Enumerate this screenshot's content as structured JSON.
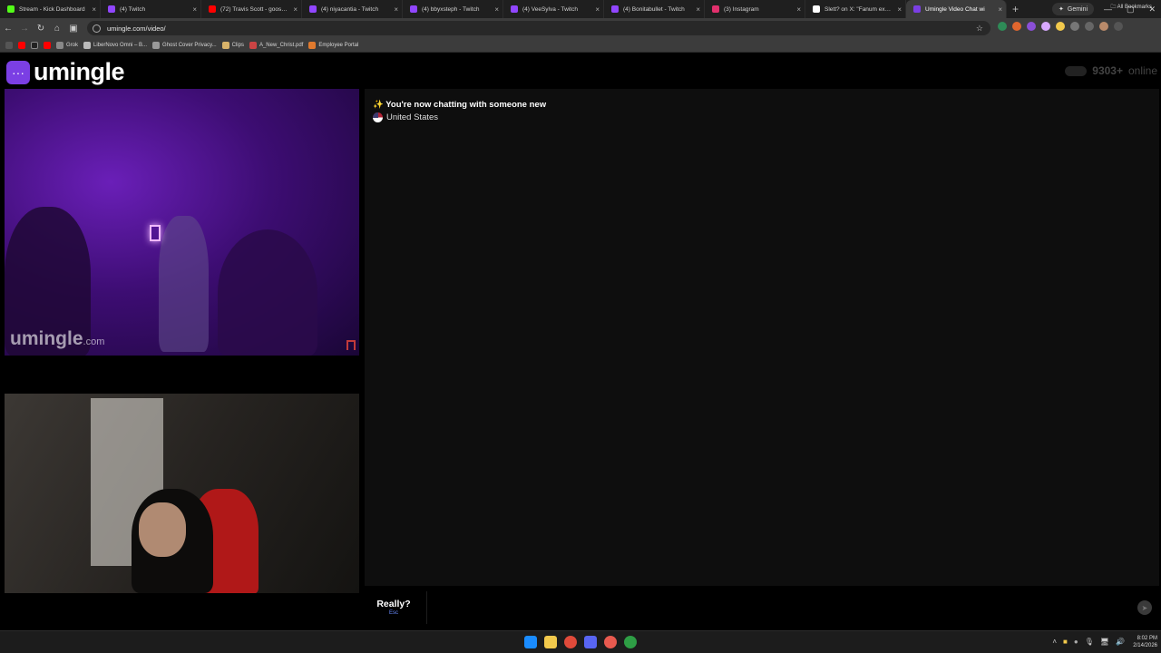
{
  "browser": {
    "tabs": [
      {
        "title": "Stream - Kick Dashboard",
        "color": "#53fc18"
      },
      {
        "title": "(4) Twitch",
        "color": "#9146ff"
      },
      {
        "title": "(72) Travis Scott - goosebum",
        "color": "#ff0000"
      },
      {
        "title": "(4) niyacantia - Twitch",
        "color": "#9146ff"
      },
      {
        "title": "(4) bbyxsteph - Twitch",
        "color": "#9146ff"
      },
      {
        "title": "(4) VeeSylva - Twitch",
        "color": "#9146ff"
      },
      {
        "title": "(4) Bonitabullet - Twitch",
        "color": "#9146ff"
      },
      {
        "title": "(3) Instagram",
        "color": "#e1306c"
      },
      {
        "title": "Slett? on X: \"Fanum exposi",
        "color": "#ffffff"
      },
      {
        "title": "Umingle Video Chat wi",
        "color": "#7b3fe4",
        "active": true
      }
    ],
    "new_tab_icon": "+",
    "gemini_label": "Gemini",
    "url": "umingle.com/video/",
    "bookmarks": [
      {
        "label": "Grok",
        "color": "#888888"
      },
      {
        "label": "LiberNovo Omni – B...",
        "color": "#bbbbbb"
      },
      {
        "label": "Ghost Cover Privacy...",
        "color": "#999999"
      },
      {
        "label": "Clips",
        "color": "#d8b36a"
      },
      {
        "label": "A_New_Christ.pdf",
        "color": "#cc4444"
      },
      {
        "label": "Employee Portal",
        "color": "#e07a2e"
      }
    ],
    "all_bookmarks_label": "All Bookmarks"
  },
  "page": {
    "logo_text": "umingle",
    "online_count": "9303+",
    "online_label": "online",
    "watermark": "umingle",
    "watermark_suffix": ".com",
    "chat": {
      "status": "✨ You're now chatting with someone new",
      "country": "United States"
    },
    "stop_button": {
      "label": "Really?",
      "hint": "Esc"
    },
    "message_input": {
      "value": "",
      "placeholder": ""
    }
  },
  "taskbar": {
    "time": "8:02 PM",
    "date": "2/14/2026"
  },
  "colors": {
    "brand": "#7b3fe4",
    "chat_bg": "#0e0e0e",
    "hint": "#6a8cff"
  }
}
